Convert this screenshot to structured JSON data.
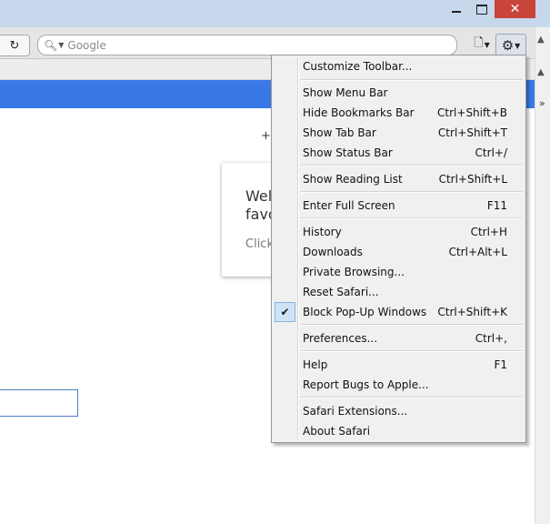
{
  "search": {
    "placeholder": "Google"
  },
  "welcome": {
    "line1": "Wel",
    "line2": "favo",
    "line3": "Click"
  },
  "page": {
    "plus_text": "+Y"
  },
  "menu": {
    "items": [
      {
        "label": "Customize Toolbar...",
        "shortcut": ""
      },
      {
        "label": "Show Menu Bar",
        "shortcut": ""
      },
      {
        "label": "Hide Bookmarks Bar",
        "shortcut": "Ctrl+Shift+B"
      },
      {
        "label": "Show Tab Bar",
        "shortcut": "Ctrl+Shift+T"
      },
      {
        "label": "Show Status Bar",
        "shortcut": "Ctrl+/"
      },
      {
        "label": "Show Reading List",
        "shortcut": "Ctrl+Shift+L"
      },
      {
        "label": "Enter Full Screen",
        "shortcut": "F11"
      },
      {
        "label": "History",
        "shortcut": "Ctrl+H"
      },
      {
        "label": "Downloads",
        "shortcut": "Ctrl+Alt+L"
      },
      {
        "label": "Private Browsing...",
        "shortcut": ""
      },
      {
        "label": "Reset Safari...",
        "shortcut": ""
      },
      {
        "label": "Block Pop-Up Windows",
        "shortcut": "Ctrl+Shift+K",
        "checked": true
      },
      {
        "label": "Preferences...",
        "shortcut": "Ctrl+,"
      },
      {
        "label": "Help",
        "shortcut": "F1"
      },
      {
        "label": "Report Bugs to Apple...",
        "shortcut": ""
      },
      {
        "label": "Safari Extensions...",
        "shortcut": ""
      },
      {
        "label": "About Safari",
        "shortcut": ""
      }
    ]
  },
  "colors": {
    "accent_bar": "#3b78e7",
    "close_button": "#c9443a",
    "check_bg": "#cfe3f8"
  },
  "icons": [
    "reload-icon",
    "search-icon",
    "page-menu-icon",
    "gear-icon",
    "minimize-icon",
    "maximize-icon",
    "close-icon",
    "checkmark-icon"
  ]
}
